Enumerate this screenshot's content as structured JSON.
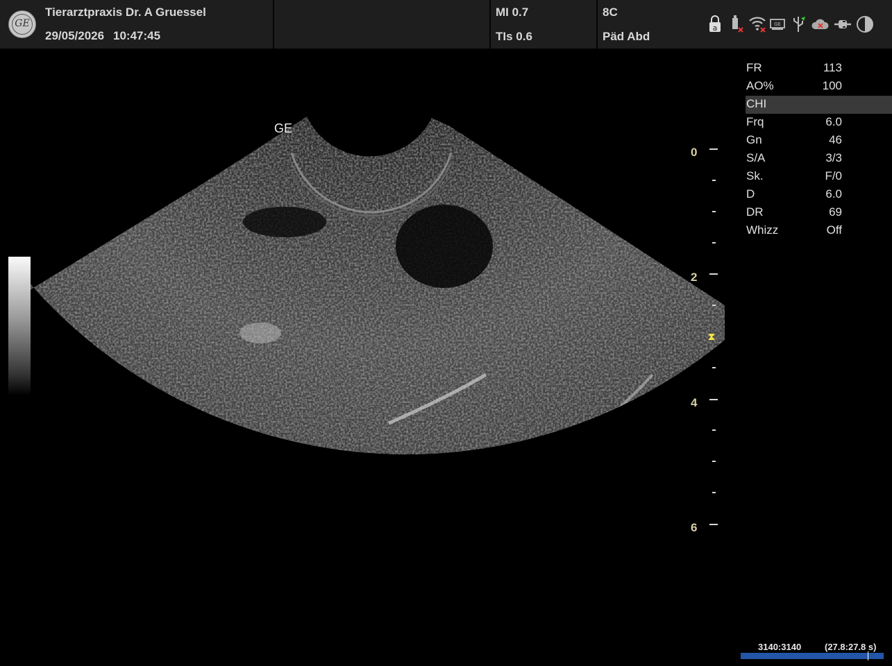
{
  "header": {
    "institution": "Tierarztpraxis Dr. A Gruessel",
    "date": "29/05/2026",
    "time": "10:47:45",
    "mi": "MI 0.7",
    "tis": "TIs 0.6",
    "probe": "8C",
    "preset": "Päd Abd",
    "logo_icon": "ge-logo-icon",
    "status_icons": [
      "lock-icon",
      "usb-disconnected-icon",
      "wifi-disconnected-icon",
      "network-disconnected-icon",
      "usb-icon",
      "cloud-disconnected-icon",
      "power-plug-icon",
      "contrast-icon"
    ]
  },
  "image": {
    "probe_label": "GE",
    "grayscale_bar": true
  },
  "depth_scale": {
    "labels": [
      "0",
      "2",
      "4",
      "6"
    ],
    "focus_marker_icon": "focus-marker-icon"
  },
  "parameters": [
    {
      "key": "FR",
      "value": "113"
    },
    {
      "key": "AO%",
      "value": "100"
    },
    {
      "key": "CHI",
      "value": "",
      "highlighted": true
    },
    {
      "key": "Frq",
      "value": "6.0"
    },
    {
      "key": "Gn",
      "value": "46"
    },
    {
      "key": "S/A",
      "value": "3/3"
    },
    {
      "key": "Sk.",
      "value": "F/0"
    },
    {
      "key": "D",
      "value": "6.0"
    },
    {
      "key": "DR",
      "value": "69"
    },
    {
      "key": "Whizz",
      "value": "Off"
    }
  ],
  "cine": {
    "frames": "3140:3140",
    "time": "(27.8:27.8 s)",
    "position_fraction": 0.89
  },
  "colors": {
    "background": "#000000",
    "header_bg": "#1e1e1e",
    "depth_label": "#d8cfa8",
    "focus_marker": "#f5e542",
    "cine_bar": "#2456a8",
    "param_highlight": "#3a3a3a"
  }
}
